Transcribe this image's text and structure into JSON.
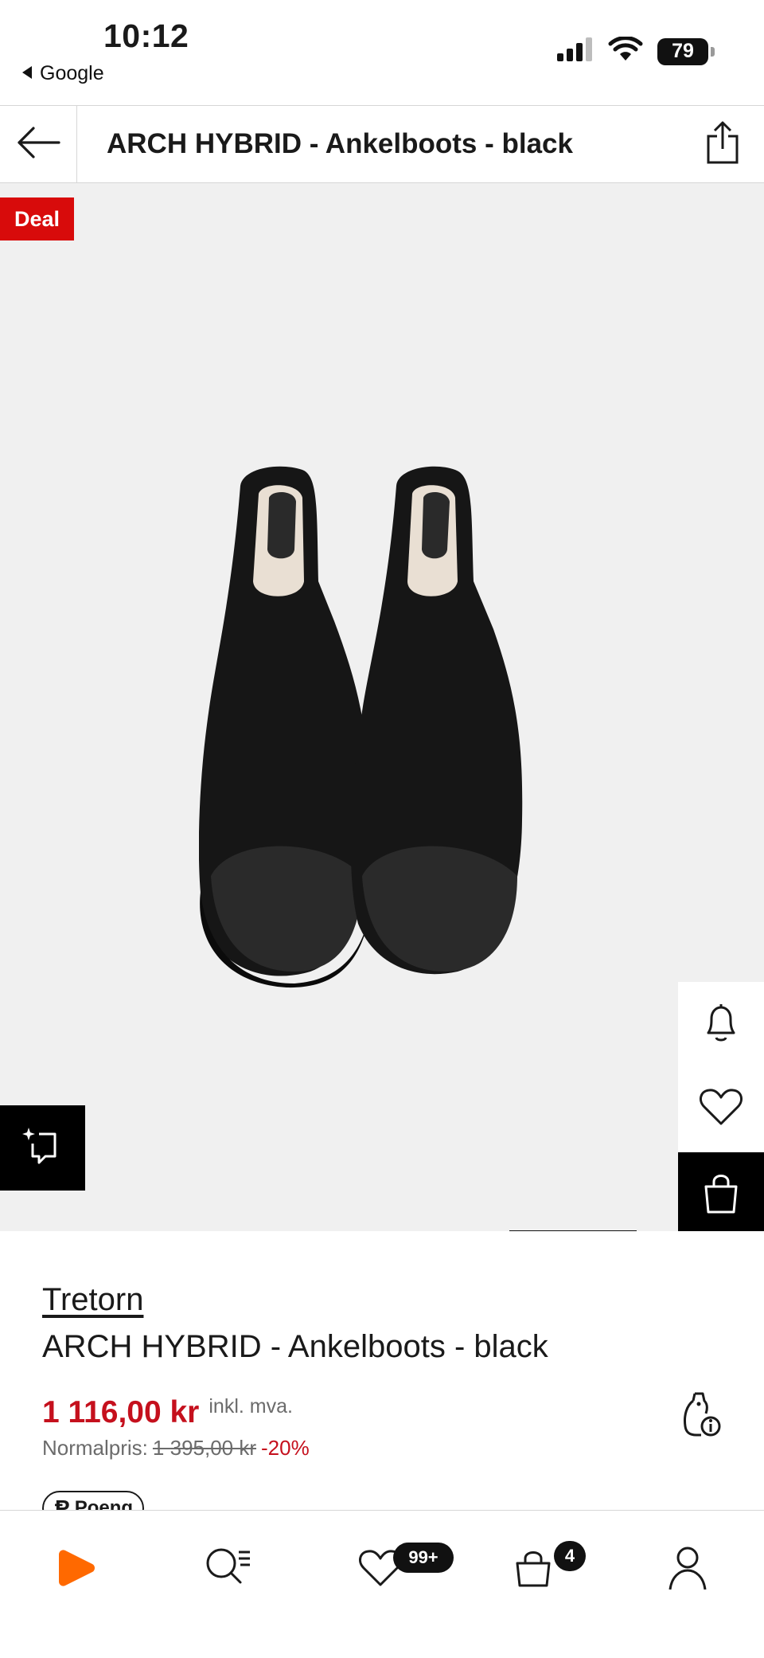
{
  "status_bar": {
    "time": "10:12",
    "back_app": "Google",
    "battery": "79",
    "icons": [
      "signal-icon",
      "wifi-icon",
      "battery-icon"
    ]
  },
  "header": {
    "title": "ARCH HYBRID - Ankelboots - black",
    "icons": [
      "back-arrow-icon",
      "share-icon"
    ]
  },
  "gallery": {
    "badge": "Deal",
    "side_actions": [
      "bell-icon",
      "heart-icon",
      "bag-icon"
    ],
    "similar_icon": "similar-items-icon"
  },
  "product": {
    "brand": "Tretorn",
    "name": "ARCH HYBRID - Ankelboots - black",
    "price": "1 116,00 kr",
    "price_note": "inkl. mva.",
    "normal_label": "Normalpris:",
    "normal_price": "1 395,00 kr",
    "discount": "-20%",
    "points_label": "Poeng"
  },
  "bottom_nav": {
    "items": [
      "home-logo",
      "search-icon",
      "wishlist-icon",
      "cart-icon",
      "account-icon"
    ],
    "wishlist_count": "99+",
    "cart_count": "4"
  },
  "colors": {
    "accent_red": "#c5101d",
    "deal_red": "#d80b0b",
    "brand_orange": "#ff6900"
  }
}
